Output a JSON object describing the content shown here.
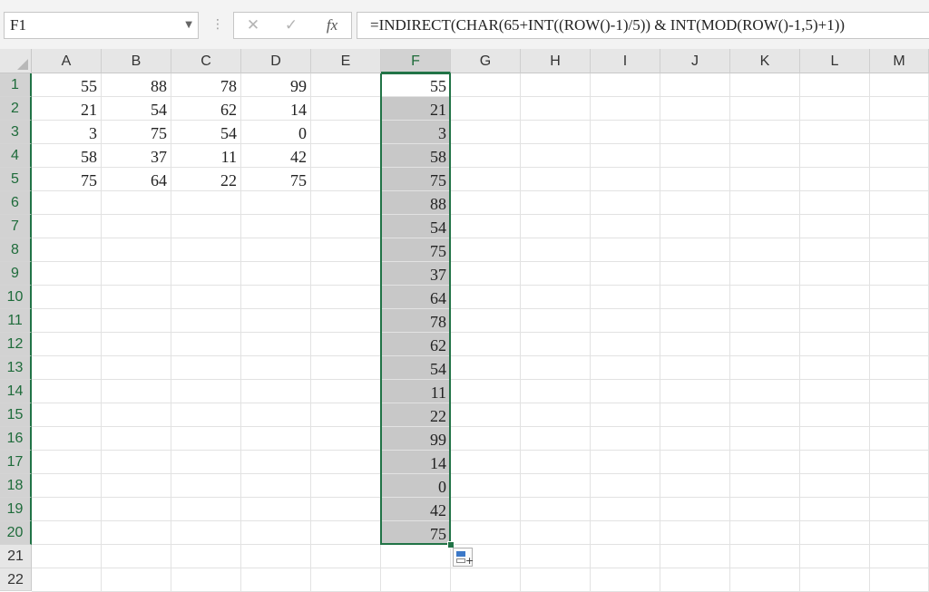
{
  "name_box": {
    "value": "F1"
  },
  "formula_bar": {
    "cancel_icon": "✕",
    "enter_icon": "✓",
    "fx_label": "fx",
    "formula": "=INDIRECT(CHAR(65+INT((ROW()-1)/5)) & INT(MOD(ROW()-1,5)+1))"
  },
  "columns": [
    "A",
    "B",
    "C",
    "D",
    "E",
    "F",
    "G",
    "H",
    "I",
    "J",
    "K",
    "L",
    "M"
  ],
  "selected_column": "F",
  "rows": [
    "1",
    "2",
    "3",
    "4",
    "5",
    "6",
    "7",
    "8",
    "9",
    "10",
    "11",
    "12",
    "13",
    "14",
    "15",
    "16",
    "17",
    "18",
    "19",
    "20",
    "21",
    "22"
  ],
  "cells": {
    "A": [
      "55",
      "21",
      "3",
      "58",
      "75"
    ],
    "B": [
      "88",
      "54",
      "75",
      "37",
      "64"
    ],
    "C": [
      "78",
      "62",
      "54",
      "11",
      "22"
    ],
    "D": [
      "99",
      "14",
      "0",
      "42",
      "75"
    ],
    "F": [
      "55",
      "21",
      "3",
      "58",
      "75",
      "88",
      "54",
      "75",
      "37",
      "64",
      "78",
      "62",
      "54",
      "11",
      "22",
      "99",
      "14",
      "0",
      "42",
      "75"
    ]
  },
  "selection_color": "#217346"
}
